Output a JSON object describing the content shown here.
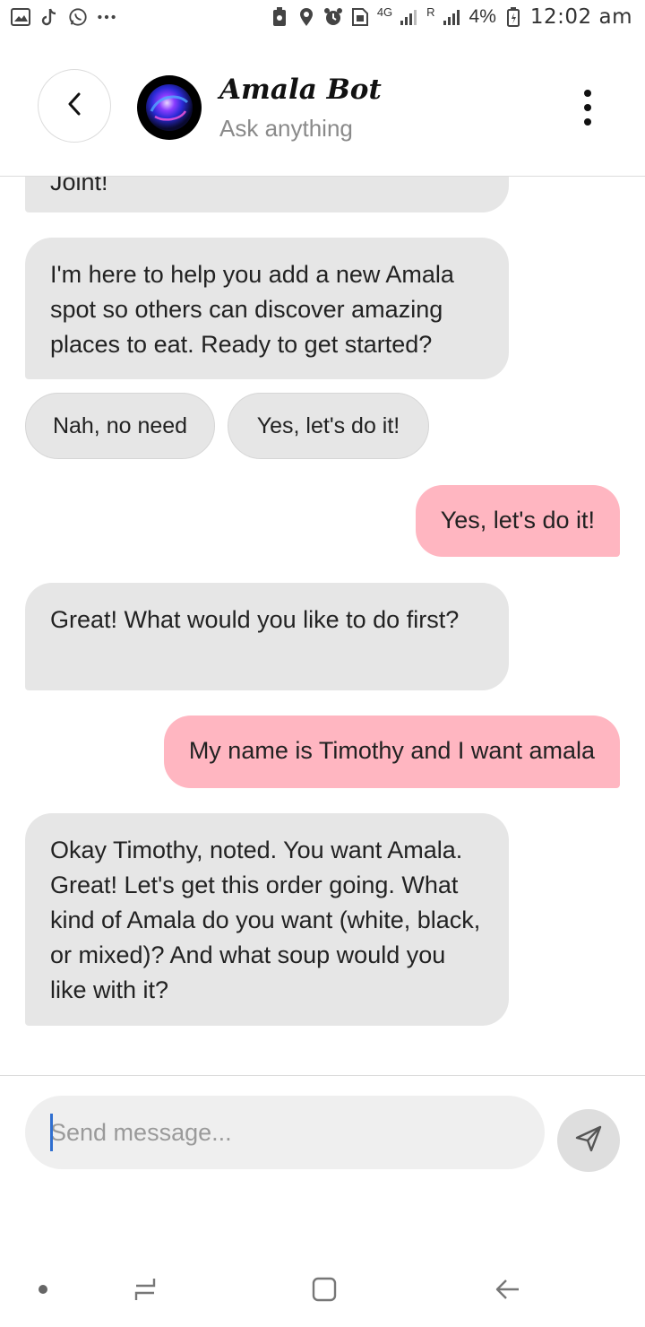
{
  "status_bar": {
    "left_icons": [
      "gallery-icon",
      "tiktok-icon",
      "whatsapp-icon",
      "more-icon"
    ],
    "network": "4G",
    "roaming": "R",
    "battery": "4%",
    "time": "12:02 am"
  },
  "header": {
    "title": "Amala Bot",
    "subtitle": "Ask anything"
  },
  "messages": [
    {
      "sender": "bot",
      "text": "Joint!"
    },
    {
      "sender": "bot",
      "text": "I'm here to help you add a new Amala spot so others can discover amazing places to eat. Ready to get started?"
    },
    {
      "sender": "user",
      "text": "Yes, let's do it!"
    },
    {
      "sender": "bot",
      "text": "Great! What would you like to do first?"
    },
    {
      "sender": "user",
      "text": "My name is Timothy and I want amala"
    },
    {
      "sender": "bot",
      "text": "Okay Timothy, noted. You want Amala. Great! Let's get this order going.  What kind of Amala do you want (white, black, or mixed)? And what soup would you like with it?"
    }
  ],
  "quick_replies": [
    "Nah, no need",
    "Yes, let's do it!"
  ],
  "composer": {
    "placeholder": "Send message..."
  },
  "colors": {
    "bot_bubble": "#e6e6e6",
    "user_bubble": "#ffb6c1",
    "input_bg": "#efefef"
  }
}
